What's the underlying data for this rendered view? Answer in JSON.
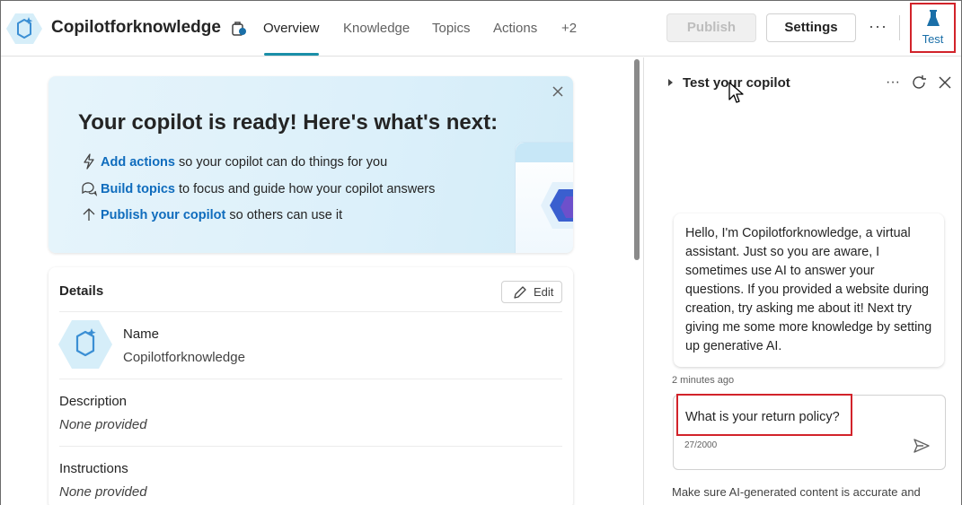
{
  "header": {
    "app_title": "Copilotforknowledge",
    "tabs": [
      {
        "label": "Overview",
        "active": true
      },
      {
        "label": "Knowledge",
        "active": false
      },
      {
        "label": "Topics",
        "active": false
      },
      {
        "label": "Actions",
        "active": false
      },
      {
        "label": "+2",
        "active": false
      }
    ],
    "publish_label": "Publish",
    "settings_label": "Settings",
    "more_label": "···",
    "test_label": "Test",
    "accent_color": "#1a8fa8",
    "highlight_color": "#d2232a"
  },
  "hero": {
    "title": "Your copilot is ready! Here's what's next:",
    "items": [
      {
        "link": "Add actions",
        "text": " so your copilot can do things for you",
        "icon": "lightning-icon"
      },
      {
        "link": "Build topics",
        "text": " to focus and guide how your copilot answers",
        "icon": "chat-bubbles-icon"
      },
      {
        "link": "Publish your copilot",
        "text": " so others can use it",
        "icon": "arrow-up-icon"
      }
    ]
  },
  "details": {
    "title": "Details",
    "edit_label": "Edit",
    "name_label": "Name",
    "name_value": "Copilotforknowledge",
    "description_label": "Description",
    "description_value": "None provided",
    "instructions_label": "Instructions",
    "instructions_value": "None provided"
  },
  "test_panel": {
    "title": "Test your copilot",
    "more_label": "···",
    "bot_message": "Hello, I'm Copilotforknowledge, a virtual assistant. Just so you are aware, I sometimes use AI to answer your questions. If you provided a website during creation, try asking me about it! Next try giving me some more knowledge by setting up generative AI.",
    "timestamp": "2 minutes ago",
    "input_value": "What is your return policy?",
    "char_count": "27/2000",
    "disclaimer": "Make sure AI-generated content is accurate and"
  }
}
